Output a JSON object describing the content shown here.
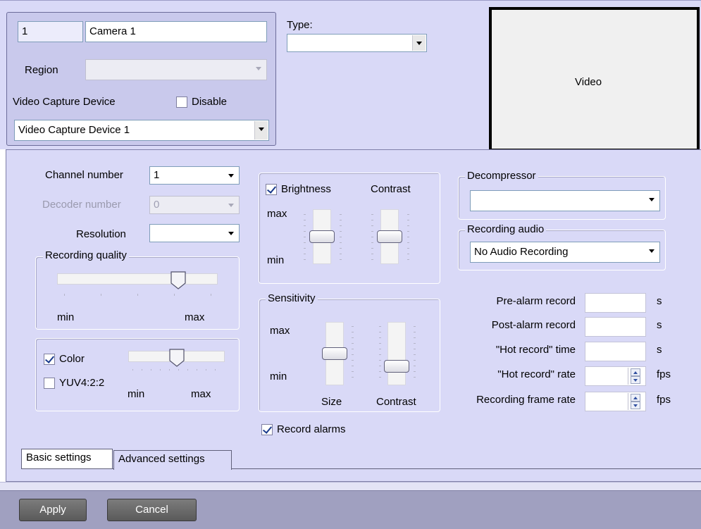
{
  "camera": {
    "id": "1",
    "name": "Camera 1",
    "region_label": "Region",
    "region_value": "",
    "capture_label": "Video Capture Device",
    "disable_label": "Disable",
    "disable_checked": false,
    "capture_value": "Video Capture Device 1"
  },
  "type": {
    "label": "Type:",
    "value": ""
  },
  "video": {
    "label": "Video"
  },
  "basic": {
    "channel_label": "Channel number",
    "channel_value": "1",
    "decoder_label": "Decoder number",
    "decoder_value": "0",
    "resolution_label": "Resolution",
    "resolution_value": "",
    "quality": {
      "legend": "Recording quality",
      "min": "min",
      "max": "max",
      "level": 0.78
    },
    "color": {
      "color_label": "Color",
      "color_checked": true,
      "yuv_label": "YUV4:2:2",
      "yuv_checked": false,
      "min": "min",
      "max": "max",
      "level": 0.5
    },
    "brightness": {
      "label": "Brightness",
      "checked": true,
      "contrast_label": "Contrast",
      "max": "max",
      "min": "min",
      "brightness_level": 0.5,
      "contrast_level": 0.5
    },
    "sensitivity": {
      "legend": "Sensitivity",
      "max": "max",
      "min": "min",
      "size_label": "Size",
      "contrast_label": "Contrast",
      "size_level": 0.5,
      "contrast_level": 0.25
    },
    "record_alarms_label": "Record alarms",
    "record_alarms_checked": true,
    "decompressor": {
      "legend": "Decompressor",
      "value": ""
    },
    "recording_audio": {
      "legend": "Recording audio",
      "value": "No Audio Recording"
    },
    "timing": [
      {
        "label": "Pre-alarm record",
        "value": "",
        "unit": "s",
        "spin": false
      },
      {
        "label": "Post-alarm record",
        "value": "",
        "unit": "s",
        "spin": false
      },
      {
        "label": "\"Hot record\" time",
        "value": "",
        "unit": "s",
        "spin": false
      },
      {
        "label": "\"Hot record\" rate",
        "value": "",
        "unit": "fps",
        "spin": true
      },
      {
        "label": "Recording frame rate",
        "value": "",
        "unit": "fps",
        "spin": true
      }
    ]
  },
  "tabs": [
    {
      "label": "Basic settings",
      "active": true
    },
    {
      "label": "Advanced settings",
      "active": false
    }
  ],
  "buttons": {
    "apply": "Apply",
    "cancel": "Cancel"
  }
}
